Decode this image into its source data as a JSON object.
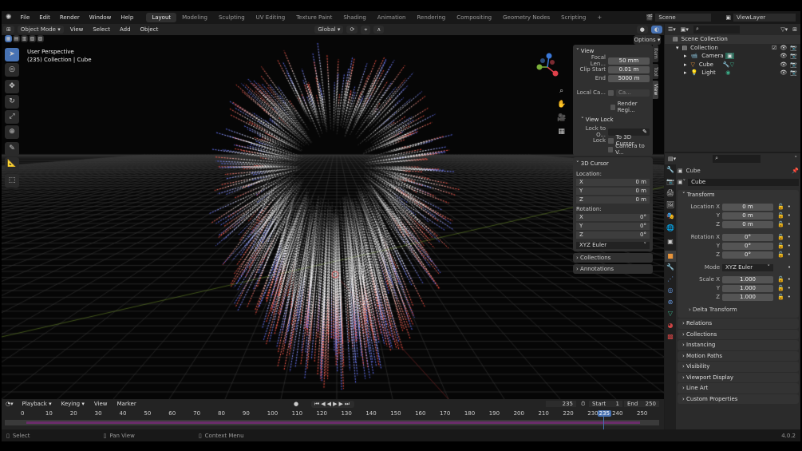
{
  "topbar": {
    "menus": [
      "File",
      "Edit",
      "Render",
      "Window",
      "Help"
    ],
    "workspaces": [
      "Layout",
      "Modeling",
      "Sculpting",
      "UV Editing",
      "Texture Paint",
      "Shading",
      "Animation",
      "Rendering",
      "Compositing",
      "Geometry Nodes",
      "Scripting"
    ],
    "add": "+",
    "scene": "Scene",
    "view_layer": "ViewLayer"
  },
  "header": {
    "mode": "Object Mode",
    "menus": [
      "View",
      "Select",
      "Add",
      "Object"
    ],
    "transform": "Global",
    "options": "Options"
  },
  "viewport": {
    "view_name": "User Perspective",
    "info": "(235) Collection | Cube"
  },
  "npanel": {
    "tabs": [
      "Item",
      "Tool",
      "View"
    ],
    "view": {
      "title": "View",
      "focal_label": "Focal Len...",
      "focal": "50 mm",
      "clip_start_label": "Clip Start",
      "clip_start": "0.01 m",
      "end_label": "End",
      "end": "5000 m",
      "local_cam_label": "Local Ca...",
      "local_cam": "Ca...",
      "render_region": "Render Regi...",
      "view_lock": "View Lock",
      "lock_obj_label": "Lock to O...",
      "lock_label": "Lock",
      "to_cursor": "To 3D Cursor",
      "camera_to_view": "Camera to V..."
    },
    "cursor": {
      "title": "3D Cursor",
      "location": "Location:",
      "loc": [
        [
          "X",
          "0 m"
        ],
        [
          "Y",
          "0 m"
        ],
        [
          "Z",
          "0 m"
        ]
      ],
      "rotation": "Rotation:",
      "rot": [
        [
          "X",
          "0°"
        ],
        [
          "Y",
          "0°"
        ],
        [
          "Z",
          "0°"
        ]
      ],
      "mode": "XYZ Euler"
    },
    "collections": "Collections",
    "annotations": "Annotations"
  },
  "outliner": {
    "scene_collection": "Scene Collection",
    "collection": "Collection",
    "items": [
      "Camera",
      "Cube",
      "Light"
    ]
  },
  "properties": {
    "object": "Cube",
    "data_name": "Cube",
    "transform": "Transform",
    "location": [
      [
        "Location X",
        "0 m"
      ],
      [
        "Y",
        "0 m"
      ],
      [
        "Z",
        "0 m"
      ]
    ],
    "rotation": [
      [
        "Rotation X",
        "0°"
      ],
      [
        "Y",
        "0°"
      ],
      [
        "Z",
        "0°"
      ]
    ],
    "mode_label": "Mode",
    "mode": "XYZ Euler",
    "scale": [
      [
        "Scale X",
        "1.000"
      ],
      [
        "Y",
        "1.000"
      ],
      [
        "Z",
        "1.000"
      ]
    ],
    "delta": "Delta Transform",
    "sections": [
      "Relations",
      "Collections",
      "Instancing",
      "Motion Paths",
      "Visibility",
      "Viewport Display",
      "Line Art",
      "Custom Properties"
    ]
  },
  "timeline": {
    "menus": [
      "Playback",
      "Keying",
      "View",
      "Marker"
    ],
    "current": "235",
    "start_label": "Start",
    "start": "1",
    "end_label": "End",
    "end": "250",
    "ticks": [
      "0",
      "10",
      "20",
      "30",
      "40",
      "50",
      "60",
      "70",
      "80",
      "90",
      "100",
      "110",
      "120",
      "130",
      "140",
      "150",
      "160",
      "170",
      "180",
      "190",
      "200",
      "210",
      "220",
      "230",
      "240",
      "250"
    ],
    "frame_badge": "235",
    "frame_start": 0,
    "frame_end": 250,
    "frame_current": 235
  },
  "status": {
    "select": "Select",
    "pan": "Pan View",
    "context": "Context Menu",
    "version": "4.0.2"
  },
  "colors": {
    "accent": "#4772b3",
    "timeline_bar": "#6b2d6b"
  }
}
